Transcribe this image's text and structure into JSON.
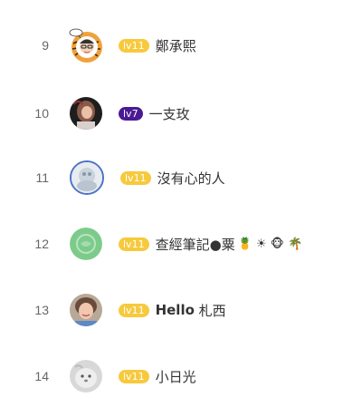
{
  "rows": [
    {
      "rank": "9",
      "level": "lv11",
      "badge_color": "#f7c93d",
      "name": "鄭承熙",
      "avatar_icon": "cartoon-tiger-frame-avatar-icon"
    },
    {
      "rank": "10",
      "level": "lv7",
      "badge_color": "#4a1a94",
      "name": "一支玫",
      "avatar_icon": "portrait-photo-avatar-icon"
    },
    {
      "rank": "11",
      "level": "lv11",
      "badge_color": "#f7c93d",
      "name": "沒有心的人",
      "avatar_icon": "blue-circle-photo-avatar-icon"
    },
    {
      "rank": "12",
      "level": "lv11",
      "badge_color": "#f7c93d",
      "name": "查經筆記●粟",
      "name_emojis": "🍍 ☀ 🐵 🌴",
      "avatar_icon": "green-circle-avatar-icon"
    },
    {
      "rank": "13",
      "level": "lv11",
      "badge_color": "#f7c93d",
      "name_bold": "Hello",
      "name": " 札西",
      "avatar_icon": "smiling-person-avatar-icon"
    },
    {
      "rank": "14",
      "level": "lv11",
      "badge_color": "#f7c93d",
      "name": "小日光",
      "avatar_icon": "gray-pet-photo-avatar-icon"
    }
  ]
}
